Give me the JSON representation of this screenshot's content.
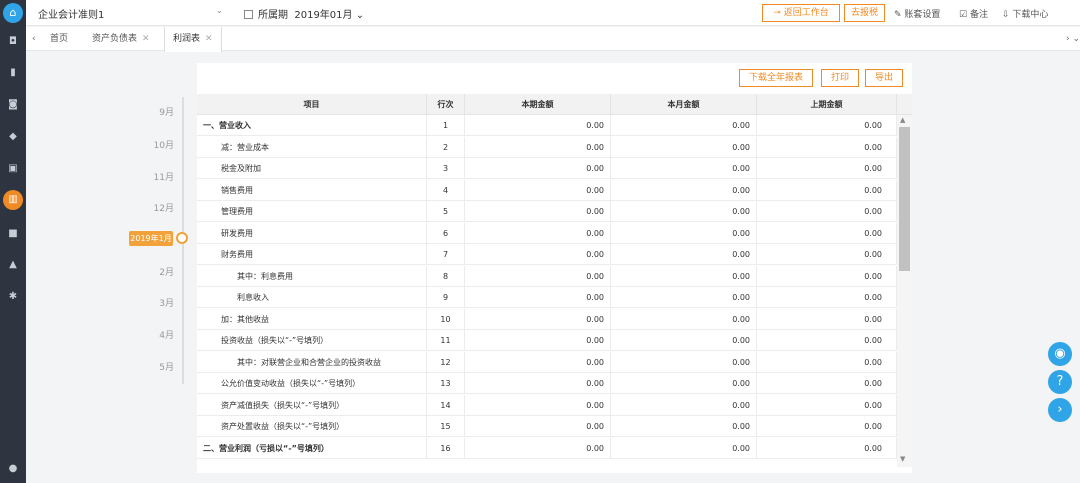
{
  "sidebar": {
    "logo_icon": "home-icon",
    "items": [
      {
        "icon": "voucher-icon",
        "glyph": "◘"
      },
      {
        "icon": "document-icon",
        "glyph": "▮"
      },
      {
        "icon": "cash-icon",
        "glyph": "◙"
      },
      {
        "icon": "wallet-icon",
        "glyph": "◆"
      },
      {
        "icon": "invoice-icon",
        "glyph": "▣"
      },
      {
        "icon": "report-chart-icon",
        "glyph": "▥",
        "active": true
      },
      {
        "icon": "folder-icon",
        "glyph": "■"
      },
      {
        "icon": "building-icon",
        "glyph": "▲"
      },
      {
        "icon": "gear-icon",
        "glyph": "✱"
      }
    ],
    "bottom_icon": "user-icon"
  },
  "topbar": {
    "account_book": "企业会计准则1",
    "period_label": "所属期",
    "period_value": "2019年01月",
    "back_button": "返回工作台",
    "tax_button": "去报税",
    "tools": [
      "账套设置",
      "备注",
      "下载中心"
    ]
  },
  "tabs": [
    {
      "label": "首页",
      "closable": false
    },
    {
      "label": "资产负债表",
      "closable": true
    },
    {
      "label": "利润表",
      "closable": true,
      "active": true
    }
  ],
  "timeline": {
    "months_before": [
      "9月",
      "10月",
      "11月",
      "12月"
    ],
    "active": "2019年1月",
    "months_after": [
      "2月",
      "3月",
      "4月",
      "5月"
    ]
  },
  "actions": {
    "download_year": "下载全年报表",
    "print": "打印",
    "export": "导出"
  },
  "table": {
    "headers": [
      "项目",
      "行次",
      "本期金额",
      "本月金额",
      "上期金额"
    ],
    "rows": [
      {
        "item": "一、营业收入",
        "no": "1",
        "current": "0.00",
        "month": "0.00",
        "previous": "0.00",
        "indent": 0,
        "bold": true
      },
      {
        "item": "减：营业成本",
        "no": "2",
        "current": "0.00",
        "month": "0.00",
        "previous": "0.00",
        "indent": 1
      },
      {
        "item": "税金及附加",
        "no": "3",
        "current": "0.00",
        "month": "0.00",
        "previous": "0.00",
        "indent": 1
      },
      {
        "item": "销售费用",
        "no": "4",
        "current": "0.00",
        "month": "0.00",
        "previous": "0.00",
        "indent": 1
      },
      {
        "item": "管理费用",
        "no": "5",
        "current": "0.00",
        "month": "0.00",
        "previous": "0.00",
        "indent": 1
      },
      {
        "item": "研发费用",
        "no": "6",
        "current": "0.00",
        "month": "0.00",
        "previous": "0.00",
        "indent": 1
      },
      {
        "item": "财务费用",
        "no": "7",
        "current": "0.00",
        "month": "0.00",
        "previous": "0.00",
        "indent": 1
      },
      {
        "item": "其中：利息费用",
        "no": "8",
        "current": "0.00",
        "month": "0.00",
        "previous": "0.00",
        "indent": 2
      },
      {
        "item": "利息收入",
        "no": "9",
        "current": "0.00",
        "month": "0.00",
        "previous": "0.00",
        "indent": 2
      },
      {
        "item": "加：其他收益",
        "no": "10",
        "current": "0.00",
        "month": "0.00",
        "previous": "0.00",
        "indent": 1
      },
      {
        "item": "投资收益（损失以“-”号填列）",
        "no": "11",
        "current": "0.00",
        "month": "0.00",
        "previous": "0.00",
        "indent": 1
      },
      {
        "item": "其中：对联营企业和合营企业的投资收益",
        "no": "12",
        "current": "0.00",
        "month": "0.00",
        "previous": "0.00",
        "indent": 2
      },
      {
        "item": "公允价值变动收益（损失以“-”号填列）",
        "no": "13",
        "current": "0.00",
        "month": "0.00",
        "previous": "0.00",
        "indent": 1
      },
      {
        "item": "资产减值损失（损失以“-”号填列）",
        "no": "14",
        "current": "0.00",
        "month": "0.00",
        "previous": "0.00",
        "indent": 1
      },
      {
        "item": "资产处置收益（损失以“-”号填列）",
        "no": "15",
        "current": "0.00",
        "month": "0.00",
        "previous": "0.00",
        "indent": 1
      },
      {
        "item": "二、营业利润（亏损以“-”号填列）",
        "no": "16",
        "current": "0.00",
        "month": "0.00",
        "previous": "0.00",
        "indent": 0,
        "bold": true
      }
    ]
  },
  "floating": [
    "eye-icon",
    "help-icon",
    "chevron-right-icon"
  ],
  "colors": {
    "accent": "#f08a24",
    "brand": "#2fa4e7",
    "sidebar": "#2e3440"
  }
}
